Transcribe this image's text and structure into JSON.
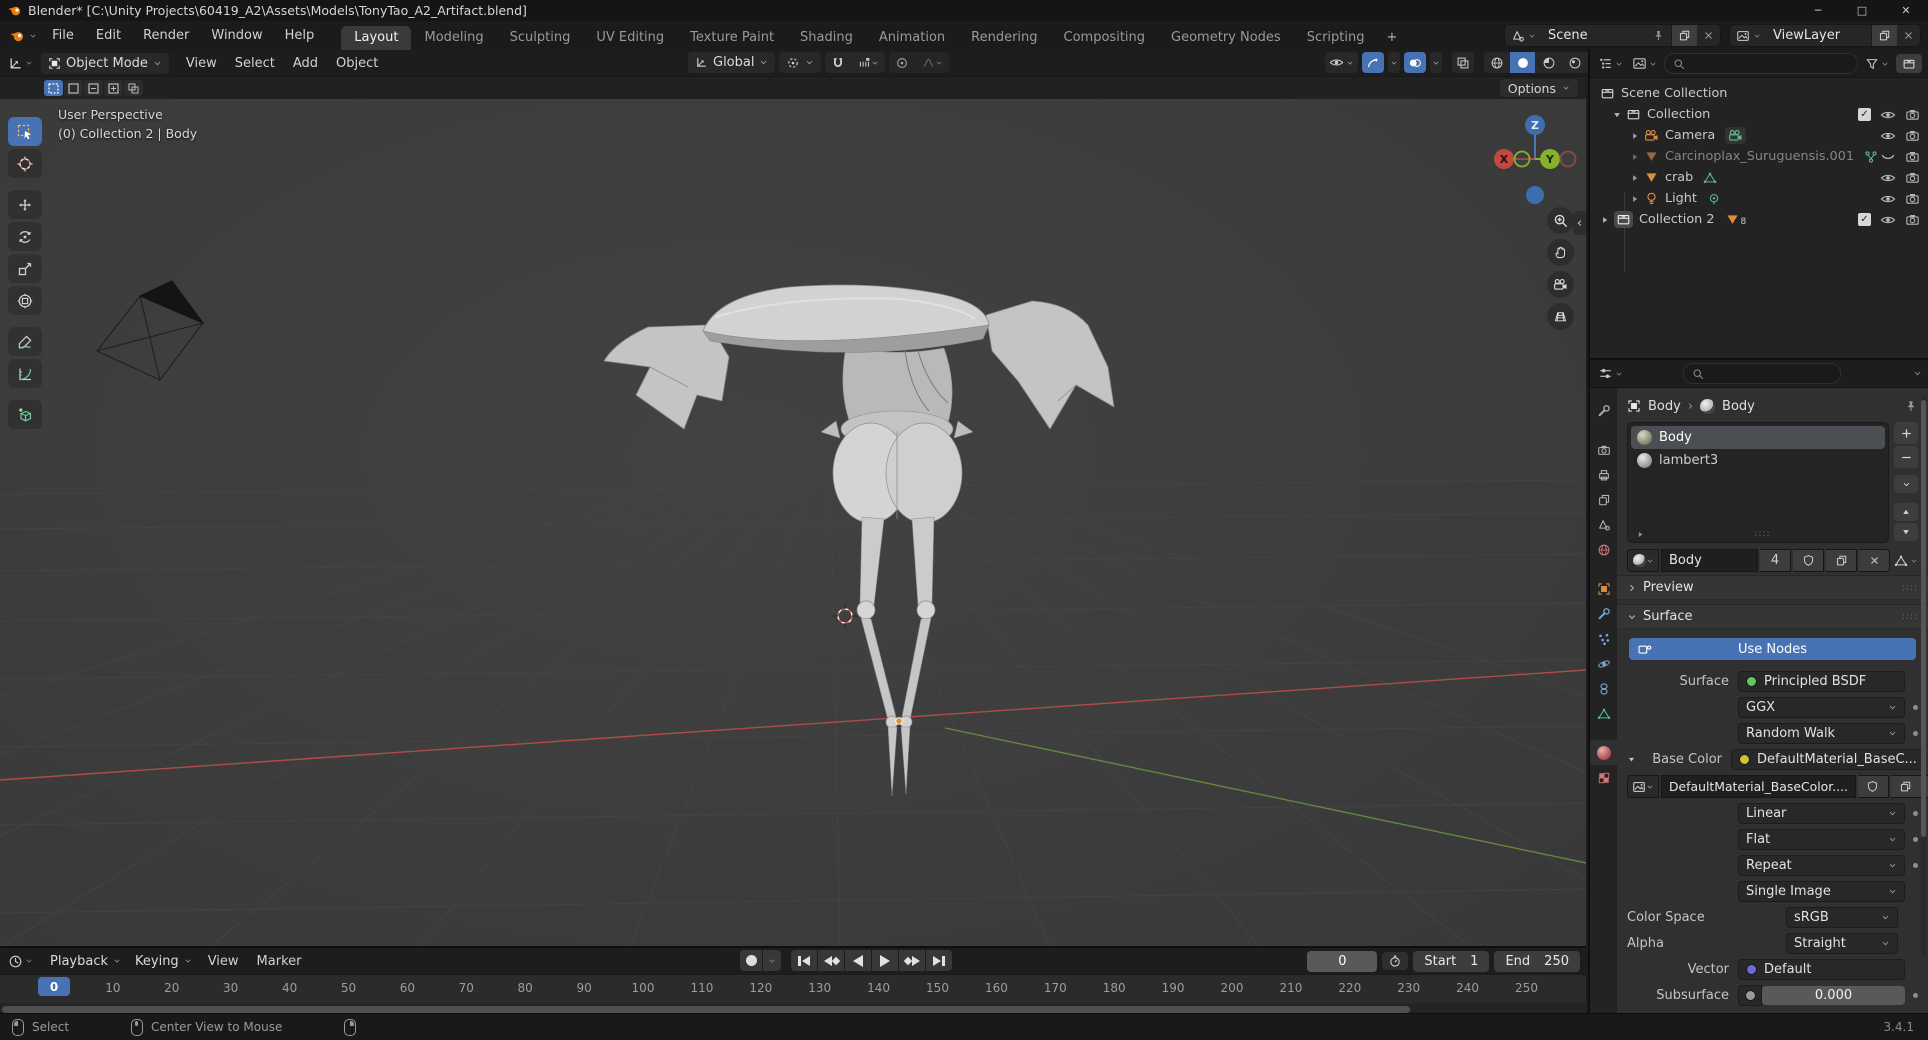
{
  "window": {
    "title": "Blender* [C:\\Unity Projects\\60419_A2\\Assets\\Models\\TonyTao_A2_Artifact.blend]",
    "minimize": "─",
    "maximize": "□",
    "close": "✕"
  },
  "menubar": {
    "menus": [
      "File",
      "Edit",
      "Render",
      "Window",
      "Help"
    ],
    "tabs": [
      "Layout",
      "Modeling",
      "Sculpting",
      "UV Editing",
      "Texture Paint",
      "Shading",
      "Animation",
      "Rendering",
      "Compositing",
      "Geometry Nodes",
      "Scripting"
    ],
    "add_tab": "+",
    "scene_name": "Scene",
    "viewlayer_name": "ViewLayer"
  },
  "viewport": {
    "mode": "Object Mode",
    "menus": [
      "View",
      "Select",
      "Add",
      "Object"
    ],
    "orientation": "Global",
    "options_label": "Options",
    "overlay_line1": "User Perspective",
    "overlay_line2": "(0) Collection 2 | Body",
    "axis": {
      "x": "X",
      "y": "Y",
      "z": "Z"
    },
    "collapse_arrow": "‹"
  },
  "outliner": {
    "rows": [
      {
        "label": "Scene Collection"
      },
      {
        "label": "Collection"
      },
      {
        "label": "Camera"
      },
      {
        "label": "Carcinoplax_Suruguensis.001"
      },
      {
        "label": "crab"
      },
      {
        "label": "Light"
      },
      {
        "label": "Collection 2",
        "count": "8"
      }
    ],
    "check": "✓"
  },
  "properties": {
    "breadcrumb_object": "Body",
    "breadcrumb_separator": "›",
    "breadcrumb_material": "Body",
    "slots": [
      "Body",
      "lambert3"
    ],
    "datablock_name": "Body",
    "users_count": "4",
    "panels": {
      "preview": "Preview",
      "surface": "Surface"
    },
    "use_nodes_label": "Use Nodes",
    "fields": {
      "surface_label": "Surface",
      "surface_value": "Principled BSDF",
      "distribution": "GGX",
      "subsurface_method": "Random Walk",
      "base_color_label": "Base Color",
      "base_color_value": "DefaultMaterial_BaseC...",
      "image_name": "DefaultMaterial_BaseColor....",
      "interpolation": "Linear",
      "projection": "Flat",
      "extension": "Repeat",
      "source": "Single Image",
      "color_space_label": "Color Space",
      "color_space": "sRGB",
      "alpha_label": "Alpha",
      "alpha_value": "Straight",
      "vector_label": "Vector",
      "vector_value": "Default",
      "subsurface_label": "Subsurface",
      "subsurface_value": "0.000"
    }
  },
  "timeline": {
    "menus": [
      "Playback",
      "Keying",
      "View",
      "Marker"
    ],
    "current_frame": "0",
    "start_label": "Start",
    "start_value": "1",
    "end_label": "End",
    "end_value": "250",
    "ticks": [
      "0",
      "10",
      "20",
      "30",
      "40",
      "50",
      "60",
      "70",
      "80",
      "90",
      "100",
      "110",
      "120",
      "130",
      "140",
      "150",
      "160",
      "170",
      "180",
      "190",
      "200",
      "210",
      "220",
      "230",
      "240",
      "250"
    ]
  },
  "statusbar": {
    "left_label": "Select",
    "middle_label": "Center View to Mouse",
    "version": "3.4.1"
  },
  "colors": {
    "accent_blue": "#4772b3",
    "object_orange": "#dd8d3a",
    "data_green": "#56bd8e",
    "axis_red": "#c04a3f",
    "axis_green": "#84b22e",
    "axis_blue": "#3d6faf"
  }
}
